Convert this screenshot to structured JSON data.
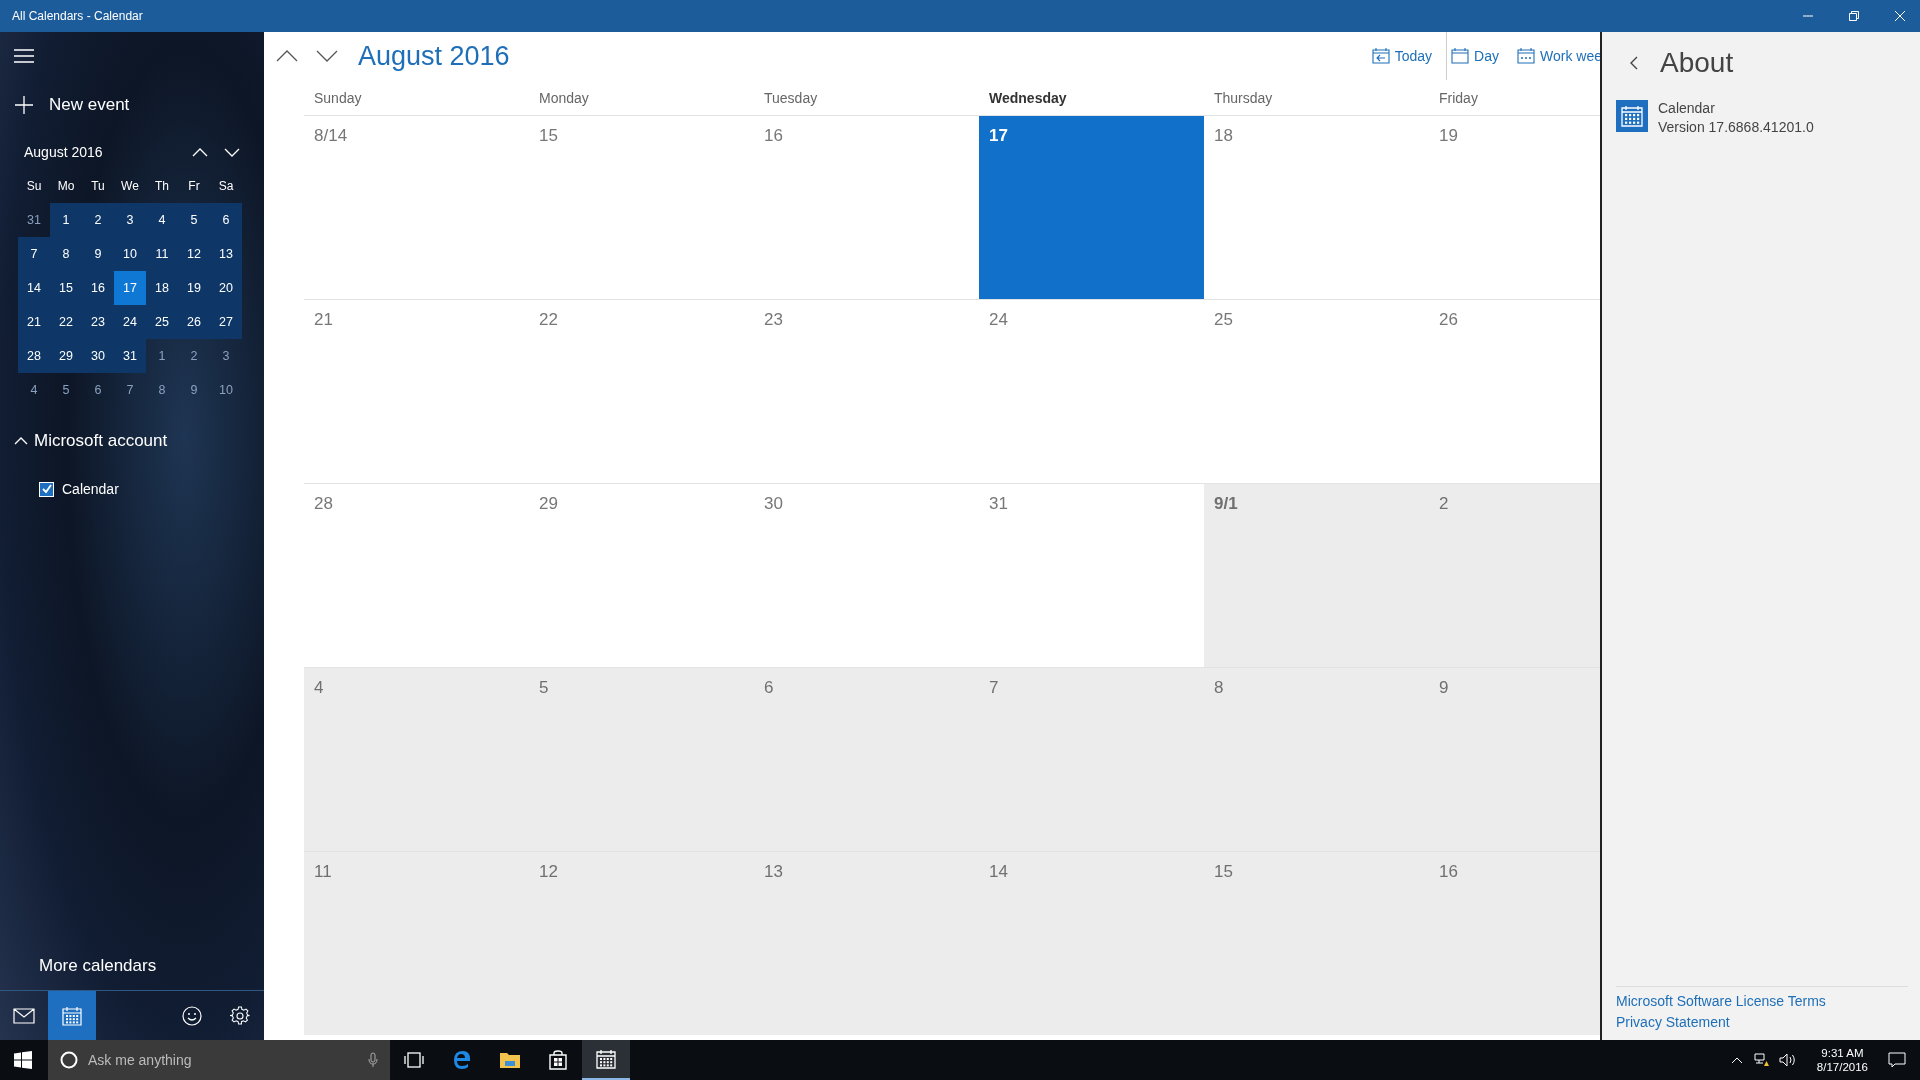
{
  "window": {
    "title": "All Calendars - Calendar"
  },
  "sidebar": {
    "new_event": "New event",
    "mini_calendar": {
      "title": "August 2016",
      "weekdays": [
        "Su",
        "Mo",
        "Tu",
        "We",
        "Th",
        "Fr",
        "Sa"
      ],
      "days": [
        {
          "label": "31",
          "in_month": false,
          "selected": false
        },
        {
          "label": "1",
          "in_month": true,
          "selected": false
        },
        {
          "label": "2",
          "in_month": true,
          "selected": false
        },
        {
          "label": "3",
          "in_month": true,
          "selected": false
        },
        {
          "label": "4",
          "in_month": true,
          "selected": false
        },
        {
          "label": "5",
          "in_month": true,
          "selected": false
        },
        {
          "label": "6",
          "in_month": true,
          "selected": false
        },
        {
          "label": "7",
          "in_month": true,
          "selected": false
        },
        {
          "label": "8",
          "in_month": true,
          "selected": false
        },
        {
          "label": "9",
          "in_month": true,
          "selected": false
        },
        {
          "label": "10",
          "in_month": true,
          "selected": false
        },
        {
          "label": "11",
          "in_month": true,
          "selected": false
        },
        {
          "label": "12",
          "in_month": true,
          "selected": false
        },
        {
          "label": "13",
          "in_month": true,
          "selected": false
        },
        {
          "label": "14",
          "in_month": true,
          "selected": false
        },
        {
          "label": "15",
          "in_month": true,
          "selected": false
        },
        {
          "label": "16",
          "in_month": true,
          "selected": false
        },
        {
          "label": "17",
          "in_month": true,
          "selected": true
        },
        {
          "label": "18",
          "in_month": true,
          "selected": false
        },
        {
          "label": "19",
          "in_month": true,
          "selected": false
        },
        {
          "label": "20",
          "in_month": true,
          "selected": false
        },
        {
          "label": "21",
          "in_month": true,
          "selected": false
        },
        {
          "label": "22",
          "in_month": true,
          "selected": false
        },
        {
          "label": "23",
          "in_month": true,
          "selected": false
        },
        {
          "label": "24",
          "in_month": true,
          "selected": false
        },
        {
          "label": "25",
          "in_month": true,
          "selected": false
        },
        {
          "label": "26",
          "in_month": true,
          "selected": false
        },
        {
          "label": "27",
          "in_month": true,
          "selected": false
        },
        {
          "label": "28",
          "in_month": true,
          "selected": false
        },
        {
          "label": "29",
          "in_month": true,
          "selected": false
        },
        {
          "label": "30",
          "in_month": true,
          "selected": false
        },
        {
          "label": "31",
          "in_month": true,
          "selected": false
        },
        {
          "label": "1",
          "in_month": false,
          "selected": false
        },
        {
          "label": "2",
          "in_month": false,
          "selected": false
        },
        {
          "label": "3",
          "in_month": false,
          "selected": false
        },
        {
          "label": "4",
          "in_month": false,
          "selected": false
        },
        {
          "label": "5",
          "in_month": false,
          "selected": false
        },
        {
          "label": "6",
          "in_month": false,
          "selected": false
        },
        {
          "label": "7",
          "in_month": false,
          "selected": false
        },
        {
          "label": "8",
          "in_month": false,
          "selected": false
        },
        {
          "label": "9",
          "in_month": false,
          "selected": false
        },
        {
          "label": "10",
          "in_month": false,
          "selected": false
        }
      ]
    },
    "account": {
      "name": "Microsoft account",
      "expanded": true,
      "calendars": [
        {
          "name": "Calendar",
          "checked": true
        }
      ]
    },
    "more_calendars": "More calendars",
    "nav": [
      {
        "kind": "mail",
        "selected": false
      },
      {
        "kind": "calendar",
        "selected": true
      },
      {
        "kind": "feedback",
        "selected": false
      },
      {
        "kind": "settings",
        "selected": false
      }
    ]
  },
  "toolbar": {
    "title": "August 2016",
    "views": [
      {
        "kind": "today",
        "label": "Today"
      },
      {
        "kind": "day",
        "label": "Day"
      },
      {
        "kind": "workweek",
        "label": "Work wee"
      }
    ]
  },
  "month": {
    "weekdays": [
      {
        "label": "Sunday",
        "today": false
      },
      {
        "label": "Monday",
        "today": false
      },
      {
        "label": "Tuesday",
        "today": false
      },
      {
        "label": "Wednesday",
        "today": true
      },
      {
        "label": "Thursday",
        "today": false
      },
      {
        "label": "Friday",
        "today": false
      }
    ],
    "weeks": [
      [
        {
          "label": "8/14",
          "in_month": true,
          "selected": false,
          "bold": false
        },
        {
          "label": "15",
          "in_month": true,
          "selected": false,
          "bold": false
        },
        {
          "label": "16",
          "in_month": true,
          "selected": false,
          "bold": false
        },
        {
          "label": "17",
          "in_month": true,
          "selected": true,
          "bold": true
        },
        {
          "label": "18",
          "in_month": true,
          "selected": false,
          "bold": false
        },
        {
          "label": "19",
          "in_month": true,
          "selected": false,
          "bold": false
        }
      ],
      [
        {
          "label": "21",
          "in_month": true,
          "selected": false,
          "bold": false
        },
        {
          "label": "22",
          "in_month": true,
          "selected": false,
          "bold": false
        },
        {
          "label": "23",
          "in_month": true,
          "selected": false,
          "bold": false
        },
        {
          "label": "24",
          "in_month": true,
          "selected": false,
          "bold": false
        },
        {
          "label": "25",
          "in_month": true,
          "selected": false,
          "bold": false
        },
        {
          "label": "26",
          "in_month": true,
          "selected": false,
          "bold": false
        }
      ],
      [
        {
          "label": "28",
          "in_month": true,
          "selected": false,
          "bold": false
        },
        {
          "label": "29",
          "in_month": true,
          "selected": false,
          "bold": false
        },
        {
          "label": "30",
          "in_month": true,
          "selected": false,
          "bold": false
        },
        {
          "label": "31",
          "in_month": true,
          "selected": false,
          "bold": false
        },
        {
          "label": "9/1",
          "in_month": false,
          "selected": false,
          "bold": true
        },
        {
          "label": "2",
          "in_month": false,
          "selected": false,
          "bold": false
        }
      ],
      [
        {
          "label": "4",
          "in_month": false,
          "selected": false,
          "bold": false
        },
        {
          "label": "5",
          "in_month": false,
          "selected": false,
          "bold": false
        },
        {
          "label": "6",
          "in_month": false,
          "selected": false,
          "bold": false
        },
        {
          "label": "7",
          "in_month": false,
          "selected": false,
          "bold": false
        },
        {
          "label": "8",
          "in_month": false,
          "selected": false,
          "bold": false
        },
        {
          "label": "9",
          "in_month": false,
          "selected": false,
          "bold": false
        }
      ],
      [
        {
          "label": "11",
          "in_month": false,
          "selected": false,
          "bold": false
        },
        {
          "label": "12",
          "in_month": false,
          "selected": false,
          "bold": false
        },
        {
          "label": "13",
          "in_month": false,
          "selected": false,
          "bold": false
        },
        {
          "label": "14",
          "in_month": false,
          "selected": false,
          "bold": false
        },
        {
          "label": "15",
          "in_month": false,
          "selected": false,
          "bold": false
        },
        {
          "label": "16",
          "in_month": false,
          "selected": false,
          "bold": false
        }
      ]
    ]
  },
  "about": {
    "title": "About",
    "app_name": "Calendar",
    "version": "Version 17.6868.41201.0",
    "links": [
      "Microsoft Software License Terms",
      "Privacy Statement"
    ]
  },
  "taskbar": {
    "search_placeholder": "Ask me anything",
    "apps": [
      {
        "kind": "taskview",
        "active": false
      },
      {
        "kind": "browser",
        "active": false
      },
      {
        "kind": "explorer",
        "active": false
      },
      {
        "kind": "store",
        "active": false
      },
      {
        "kind": "calendar",
        "active": true
      }
    ],
    "time": "9:31 AM",
    "date": "8/17/2016"
  }
}
